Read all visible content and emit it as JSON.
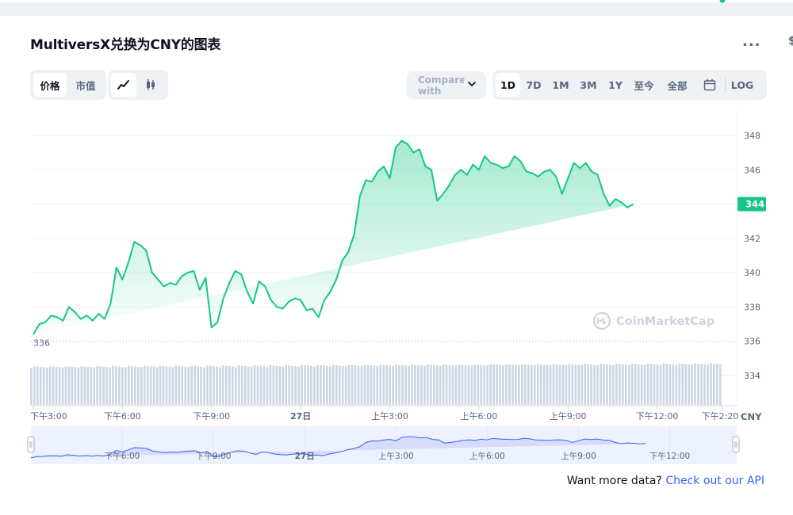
{
  "header": {
    "title": "MultiversX兑换为CNY的图表",
    "more_label": "..."
  },
  "toolbar": {
    "metric_tabs": [
      {
        "label": "价格",
        "active": true
      },
      {
        "label": "市值",
        "active": false
      }
    ],
    "chart_types": [
      {
        "icon": "line-chart-icon",
        "active": true
      },
      {
        "icon": "candlestick-icon",
        "active": false
      }
    ],
    "compare_label": "Compare with",
    "ranges": [
      {
        "label": "1D",
        "active": true
      },
      {
        "label": "7D",
        "active": false
      },
      {
        "label": "1M",
        "active": false
      },
      {
        "label": "3M",
        "active": false
      },
      {
        "label": "1Y",
        "active": false
      },
      {
        "label": "至今",
        "active": false
      },
      {
        "label": "全部",
        "active": false
      }
    ],
    "calendar_icon": "calendar-icon",
    "log_label": "LOG"
  },
  "chart_data": {
    "type": "area",
    "currency": "CNY",
    "ylim": [
      333,
      349
    ],
    "yticks": [
      348,
      346,
      344,
      342,
      340,
      338,
      336,
      334
    ],
    "open_value": 336,
    "open_label": "336",
    "last_value": 344,
    "last_label": "344",
    "watermark": "CoinMarketCap",
    "xticks": [
      {
        "t": 0.0,
        "label": "下午3:00"
      },
      {
        "t": 3.0,
        "label": "下午6:00"
      },
      {
        "t": 6.0,
        "label": "下午9:00"
      },
      {
        "t": 9.0,
        "label": "27日"
      },
      {
        "t": 12.0,
        "label": "上午3:00"
      },
      {
        "t": 15.0,
        "label": "上午6:00"
      },
      {
        "t": 18.0,
        "label": "上午9:00"
      },
      {
        "t": 21.0,
        "label": "下午12:00"
      },
      {
        "t": 23.2,
        "label": "下午2:20"
      }
    ],
    "x_hours": [
      0,
      0.2,
      0.4,
      0.6,
      0.8,
      1.0,
      1.2,
      1.4,
      1.6,
      1.8,
      2.0,
      2.2,
      2.4,
      2.6,
      2.8,
      3.0,
      3.2,
      3.4,
      3.6,
      3.8,
      4.0,
      4.2,
      4.4,
      4.6,
      4.8,
      5.0,
      5.2,
      5.4,
      5.6,
      5.8,
      6.0,
      6.2,
      6.4,
      6.6,
      6.8,
      7.0,
      7.2,
      7.4,
      7.6,
      7.8,
      8.0,
      8.2,
      8.4,
      8.6,
      8.8,
      9.0,
      9.2,
      9.4,
      9.6,
      9.8,
      10.0,
      10.2,
      10.4,
      10.6,
      10.8,
      11.0,
      11.2,
      11.4,
      11.6,
      11.8,
      12.0,
      12.2,
      12.4,
      12.6,
      12.8,
      13.0,
      13.2,
      13.4,
      13.6,
      13.8,
      14.0,
      14.2,
      14.4,
      14.6,
      14.8,
      15.0,
      15.2,
      15.4,
      15.6,
      15.8,
      16.0,
      16.2,
      16.4,
      16.6,
      16.8,
      17.0,
      17.2,
      17.4,
      17.6,
      17.8,
      18.0,
      18.2,
      18.4,
      18.6,
      18.8,
      19.0,
      19.2,
      19.4,
      19.6,
      19.8,
      20.0,
      20.2,
      20.4,
      20.6,
      20.8,
      21.0,
      21.2,
      21.4,
      21.6,
      21.8,
      22.0,
      22.2,
      22.4,
      22.6,
      22.8,
      23.0,
      23.2
    ],
    "prices": [
      336.4,
      337.0,
      337.1,
      337.5,
      337.4,
      337.2,
      338.0,
      337.7,
      337.3,
      337.5,
      337.2,
      337.6,
      337.3,
      338.2,
      340.3,
      339.6,
      340.6,
      341.8,
      341.6,
      341.3,
      340.0,
      339.6,
      339.2,
      339.4,
      339.3,
      339.8,
      340.0,
      340.1,
      339.0,
      339.7,
      336.8,
      337.1,
      338.5,
      339.4,
      340.1,
      339.9,
      338.9,
      338.2,
      339.5,
      339.2,
      338.4,
      338.0,
      337.9,
      338.3,
      338.5,
      338.4,
      337.8,
      337.9,
      337.4,
      338.4,
      338.9,
      339.6,
      340.7,
      341.2,
      342.2,
      344.5,
      345.4,
      345.3,
      345.9,
      346.2,
      345.5,
      347.3,
      347.7,
      347.5,
      347.0,
      347.2,
      346.2,
      346.0,
      344.2,
      344.6,
      345.1,
      345.7,
      346.0,
      345.7,
      346.3,
      346.0,
      346.8,
      346.4,
      346.3,
      346.1,
      346.2,
      346.8,
      346.5,
      345.9,
      345.8,
      345.6,
      345.9,
      346.0,
      345.6,
      344.6,
      345.5,
      346.4,
      346.1,
      346.4,
      345.9,
      345.7,
      344.6,
      343.9,
      344.3,
      344.1,
      343.8,
      344.0
    ],
    "volume_bars": 220,
    "navigator_labels": [
      "下午6:00",
      "下午9:00",
      "27日",
      "上午3:00",
      "上午6:00",
      "上午9:00",
      "下午12:00"
    ],
    "navigator_tick_hours": [
      3.0,
      6.0,
      9.0,
      12.0,
      15.0,
      18.0,
      21.0
    ]
  },
  "colors": {
    "line": "#16c784",
    "fill_top": "#16c784",
    "grid": "#eff2f5",
    "text_muted": "#58667e",
    "navigator_fill": "#dde3ff",
    "navigator_line": "#3861fb",
    "volume": "#cfd6e4"
  },
  "footer": {
    "prompt": "Want more data?",
    "link": "Check out our API"
  }
}
